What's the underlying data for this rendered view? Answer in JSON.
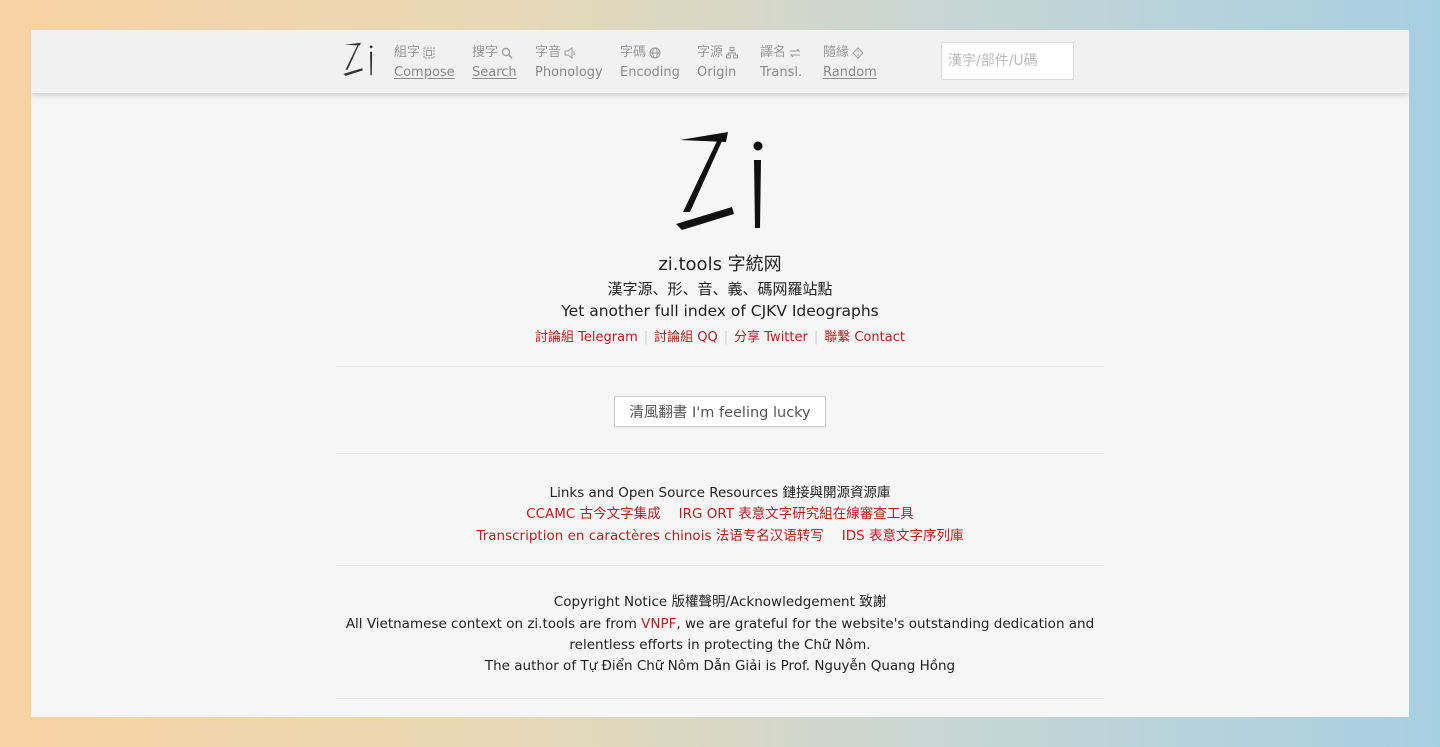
{
  "nav": {
    "items": [
      {
        "zh": "組字",
        "en": "Compose",
        "icon": "grid-icon",
        "underline": true
      },
      {
        "zh": "搜字",
        "en": "Search",
        "icon": "search-icon",
        "underline": true
      },
      {
        "zh": "字音",
        "en": "Phonology",
        "icon": "speaker-icon",
        "underline": false
      },
      {
        "zh": "字碼",
        "en": "Encoding",
        "icon": "globe-icon",
        "underline": false
      },
      {
        "zh": "字源",
        "en": "Origin",
        "icon": "sitemap-icon",
        "underline": false
      },
      {
        "zh": "譯名",
        "en": "Transl.",
        "icon": "exchange-icon",
        "underline": false
      },
      {
        "zh": "隨緣",
        "en": "Random",
        "icon": "dice-icon",
        "underline": true
      }
    ],
    "search_placeholder": "漢字/部件/U碼"
  },
  "hero": {
    "title": "zi.tools 字統网",
    "subtitle_zh": "漢字源、形、音、義、碼网羅站點",
    "subtitle_en": "Yet another full index of CJKV Ideographs"
  },
  "community": [
    {
      "label": "討論組 Telegram"
    },
    {
      "label": "討論組 QQ"
    },
    {
      "label": "分享 Twitter"
    },
    {
      "label": "聯繫 Contact"
    }
  ],
  "lucky_button": "清風翻書 I'm feeling lucky",
  "links": {
    "title": "Links and Open Source Resources 鏈接與開源資源庫",
    "row1": [
      "CCAMC 古今文字集成",
      "IRG ORT 表意文字研究組在線審查工具"
    ],
    "row2": [
      "Transcription en caractères chinois 法语专名汉语转写",
      "IDS 表意文字序列庫"
    ]
  },
  "notice": {
    "title": "Copyright Notice 版權聲明/Acknowledgement 致謝",
    "line1_pre": "All Vietnamese context on zi.tools are from ",
    "line1_link": "VNPF",
    "line1_post": ", we are grateful for the website's outstanding dedication and",
    "line2": "relentless efforts in protecting the Chữ Nôm.",
    "line3": "The author of Tự Điển Chữ Nôm Dẫn Giải is Prof. Nguyễn Quang Hồng"
  },
  "colors": {
    "accent_red": "#b52121",
    "page_bg": "#f6f6f6"
  }
}
